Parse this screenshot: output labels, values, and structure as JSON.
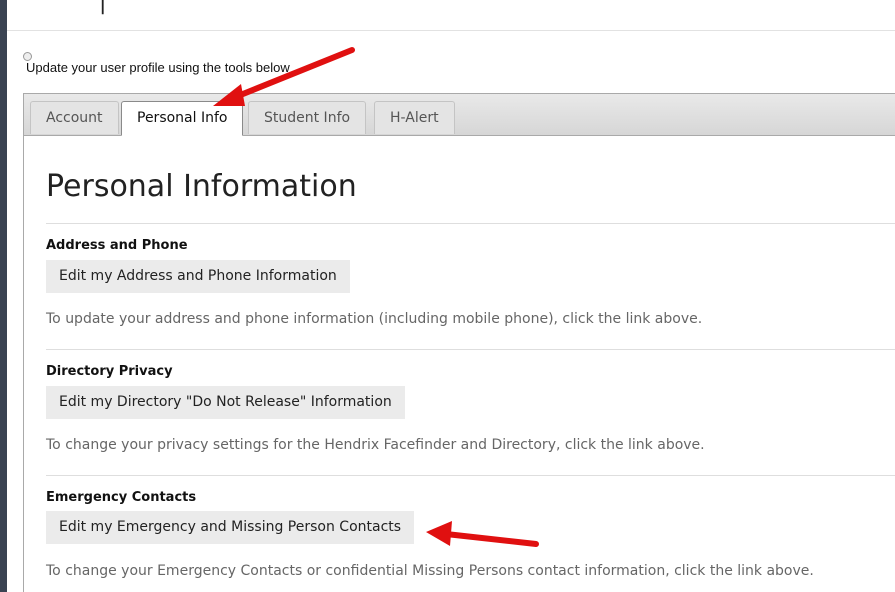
{
  "intro_text": "Update your user profile using the tools below",
  "tabs": [
    {
      "label": "Account",
      "active": false
    },
    {
      "label": "Personal Info",
      "active": true
    },
    {
      "label": "Student Info",
      "active": false
    },
    {
      "label": "H-Alert",
      "active": false
    }
  ],
  "page_title": "Personal Information",
  "sections": [
    {
      "title": "Address and Phone",
      "link_label": "Edit my Address and Phone Information",
      "description": "To update your address and phone information (including mobile phone), click the link above."
    },
    {
      "title": "Directory Privacy",
      "link_label": "Edit my Directory \"Do Not Release\" Information",
      "description": "To change your privacy settings for the Hendrix Facefinder and Directory, click the link above."
    },
    {
      "title": "Emergency Contacts",
      "link_label": "Edit my Emergency and Missing Person Contacts",
      "description": "To change your Emergency Contacts or confidential Missing Persons contact information, click the link above."
    }
  ],
  "colors": {
    "annotation_arrow": "#e01010",
    "button_bg": "#ebebeb",
    "background": "#3a4352"
  }
}
